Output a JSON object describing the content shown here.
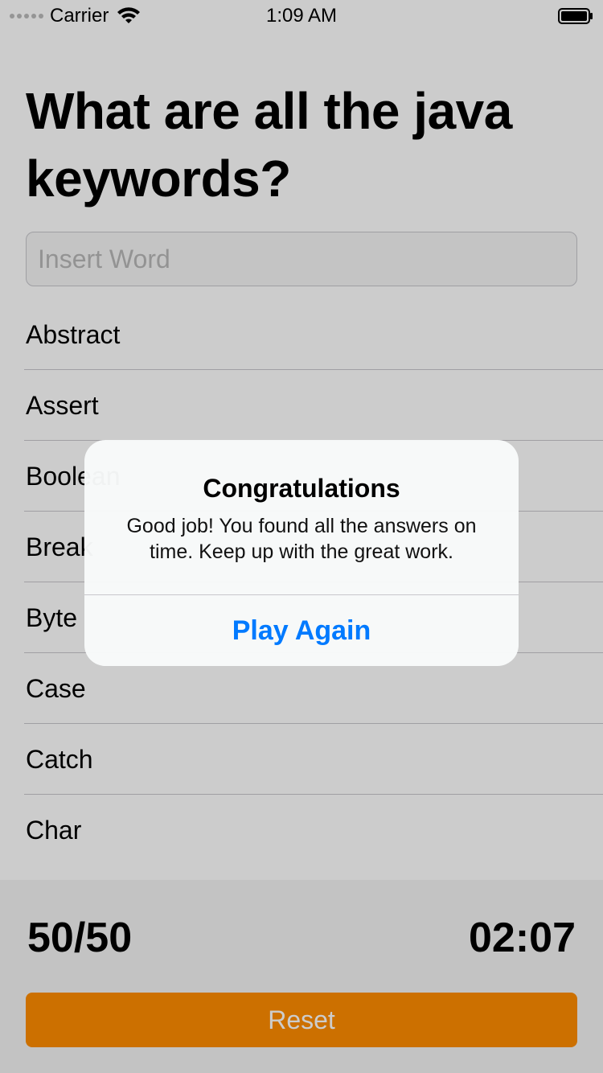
{
  "status_bar": {
    "carrier": "Carrier",
    "time": "1:09 AM",
    "wifi_icon": "wifi-icon",
    "battery_icon": "battery-icon"
  },
  "title": "What are all the java keywords?",
  "input": {
    "placeholder": "Insert Word",
    "value": ""
  },
  "keywords": [
    "Abstract",
    "Assert",
    "Boolean",
    "Break",
    "Byte",
    "Case",
    "Catch",
    "Char"
  ],
  "footer": {
    "score": "50/50",
    "timer": "02:07",
    "reset_label": "Reset",
    "reset_color": "#ff8c00"
  },
  "alert": {
    "title": "Congratulations",
    "message": "Good job! You found all the answers on time. Keep up with the great work.",
    "button_label": "Play Again",
    "button_color": "#007aff"
  }
}
